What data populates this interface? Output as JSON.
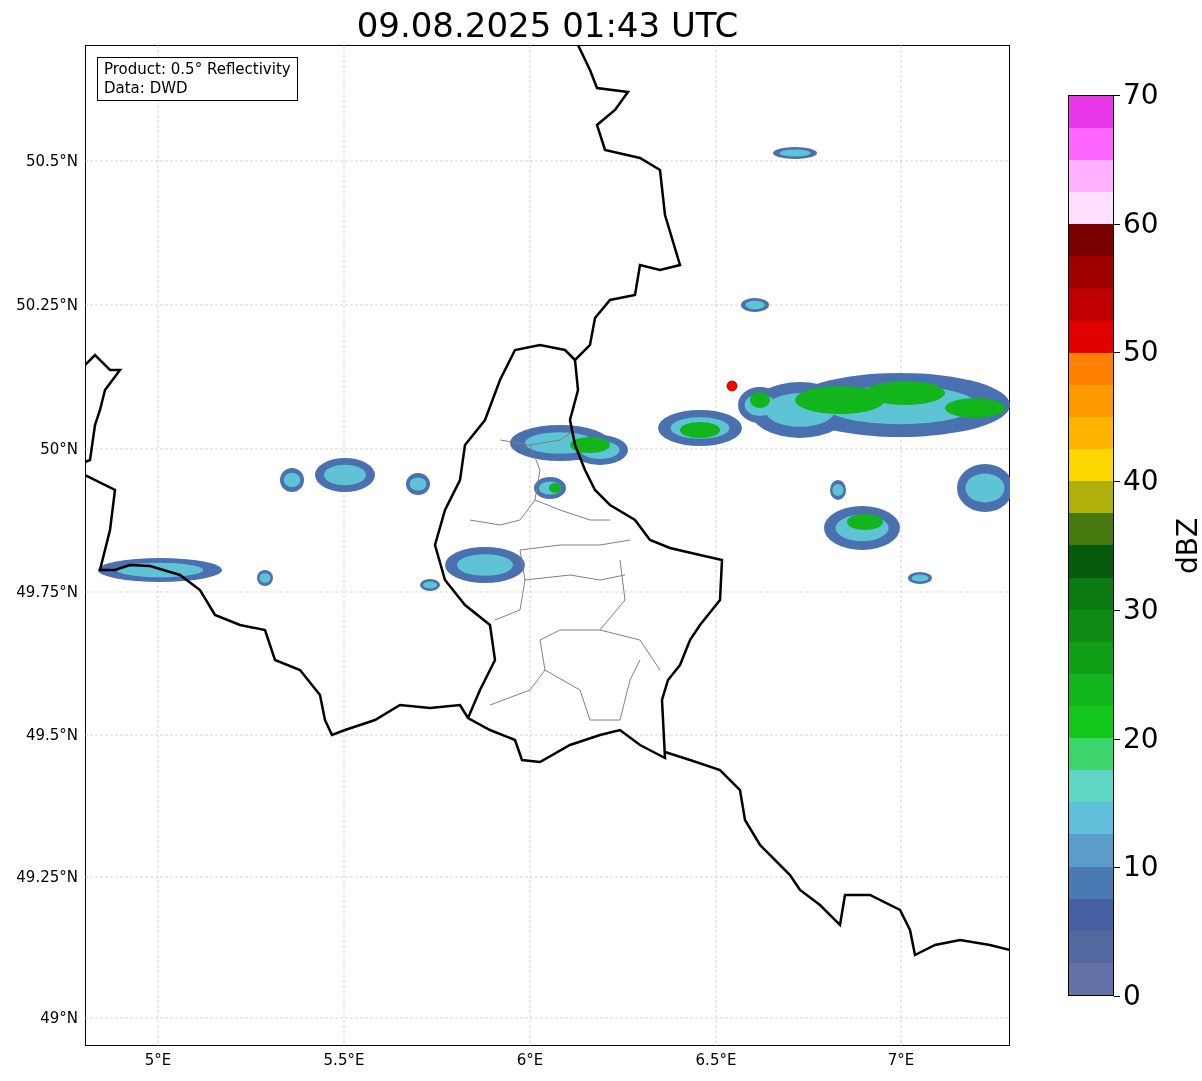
{
  "title": "09.08.2025 01:43 UTC",
  "info_box": {
    "lines": [
      "Product: 0.5° Reflectivity",
      "Data: DWD"
    ]
  },
  "map": {
    "x_ticks": [
      "5°E",
      "5.5°E",
      "6°E",
      "6.5°E",
      "7°E"
    ],
    "y_ticks": [
      "50.5°N",
      "50.25°N",
      "50°N",
      "49.75°N",
      "49.5°N",
      "49.25°N",
      "49°N"
    ]
  },
  "colorbar": {
    "label": "dBZ",
    "ticks": [
      "70",
      "60",
      "50",
      "40",
      "30",
      "20",
      "10",
      "0"
    ],
    "segments": [
      {
        "color": "#6472a8"
      },
      {
        "color": "#5468a0"
      },
      {
        "color": "#4560a3"
      },
      {
        "color": "#4a7ab3"
      },
      {
        "color": "#5a9dc8"
      },
      {
        "color": "#63c0dd"
      },
      {
        "color": "#5fd6c4"
      },
      {
        "color": "#3dd66e"
      },
      {
        "color": "#12c81a"
      },
      {
        "color": "#12b51c"
      },
      {
        "color": "#10a018"
      },
      {
        "color": "#0f8a15"
      },
      {
        "color": "#0b7a12"
      },
      {
        "color": "#065a0e"
      },
      {
        "color": "#467a0e"
      },
      {
        "color": "#b0b00a"
      },
      {
        "color": "#ffd700"
      },
      {
        "color": "#ffb400"
      },
      {
        "color": "#ff9900"
      },
      {
        "color": "#ff7f00"
      },
      {
        "color": "#e00000"
      },
      {
        "color": "#c00000"
      },
      {
        "color": "#a00000"
      },
      {
        "color": "#7a0000"
      },
      {
        "color": "#ffe0ff"
      },
      {
        "color": "#ffb0ff"
      },
      {
        "color": "#ff66ff"
      },
      {
        "color": "#e936e9"
      }
    ]
  }
}
